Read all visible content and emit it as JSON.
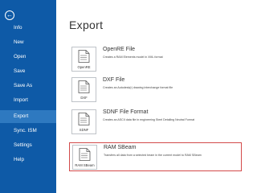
{
  "sidebar": {
    "back_label": "←",
    "items": [
      {
        "label": "Info",
        "active": false
      },
      {
        "label": "New",
        "active": false
      },
      {
        "label": "Open",
        "active": false
      },
      {
        "label": "Save",
        "active": false
      },
      {
        "label": "Save As",
        "active": false
      },
      {
        "label": "Import",
        "active": false
      },
      {
        "label": "Export",
        "active": true
      },
      {
        "label": "Sync. ISM",
        "active": false
      },
      {
        "label": "Settings",
        "active": false
      },
      {
        "label": "Help",
        "active": false
      }
    ]
  },
  "main": {
    "title": "Export",
    "items": [
      {
        "icon_label": "OpenRE",
        "title": "OpenRE File",
        "description": "Creates a RAM Elements model in XML format",
        "icon": "document-icon",
        "highlighted": false
      },
      {
        "icon_label": "DXF",
        "title": "DXF File",
        "description": "Creates an Autodesk(r) drawing interchange format file",
        "icon": "document-icon",
        "highlighted": false
      },
      {
        "icon_label": "SDNF",
        "title": "SDNF File Format",
        "description": "Creates an ASCII data file in engineering Steel Detailing Neutral Format",
        "icon": "document-icon",
        "highlighted": false
      },
      {
        "icon_label": "RAM SBeam",
        "title": "RAM SBeam",
        "description": "Transfers all data from a selected beam in the current model to RAM SBeam",
        "icon": "document-icon",
        "highlighted": true
      }
    ]
  },
  "colors": {
    "sidebar_bg": "#0e5aa7",
    "sidebar_active": "#2e79c0",
    "highlight_border": "#d34a4a"
  }
}
